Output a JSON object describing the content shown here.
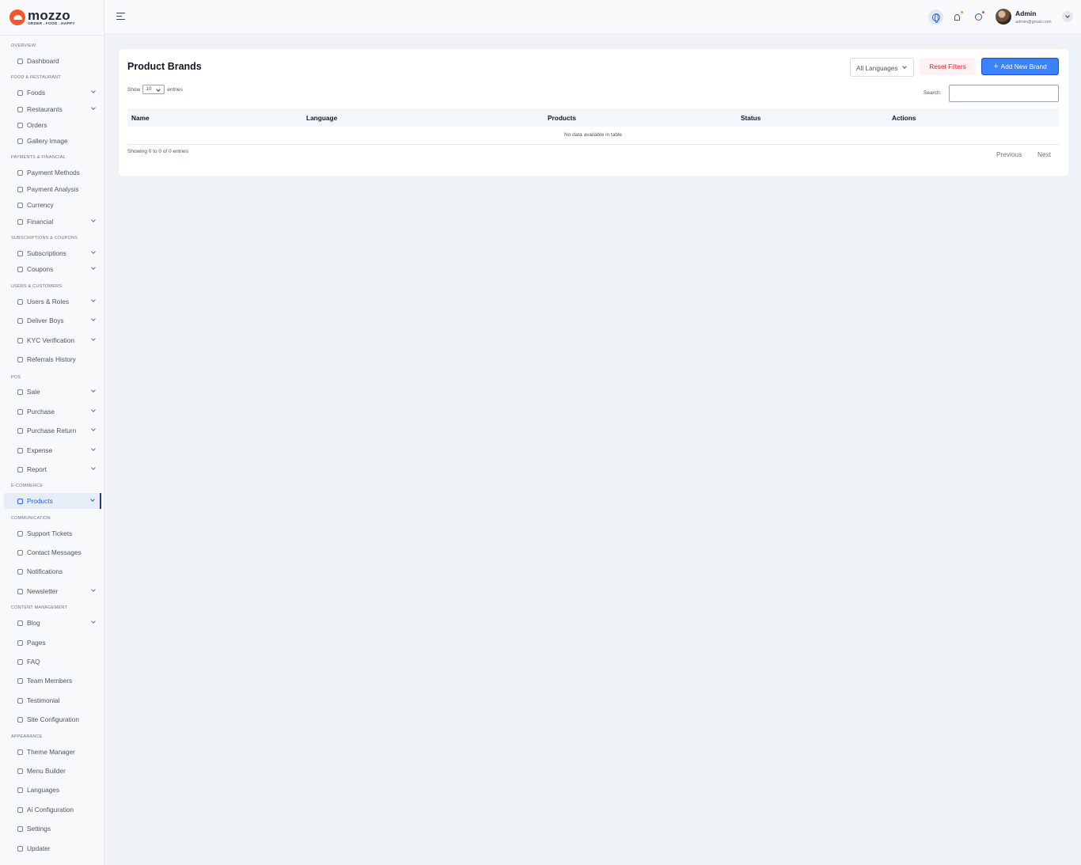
{
  "brand": {
    "name": "mozzo",
    "tagline": "ORDER . FOOD . HAPPY"
  },
  "sidebar": {
    "sections": [
      {
        "label": "OVERVIEW",
        "items": [
          {
            "label": "Dashboard",
            "icon": "home-icon",
            "expandable": false
          }
        ]
      },
      {
        "label": "FOOD & RESTAURANT",
        "items": [
          {
            "label": "Foods",
            "icon": "food-icon",
            "expandable": true
          },
          {
            "label": "Restaurants",
            "icon": "restaurant-icon",
            "expandable": true
          },
          {
            "label": "Orders",
            "icon": "orders-icon",
            "expandable": false
          },
          {
            "label": "Gallery Image",
            "icon": "gallery-icon",
            "expandable": false
          }
        ]
      },
      {
        "label": "PAYMENTS & FINANCIAL",
        "items": [
          {
            "label": "Payment Methods",
            "icon": "card-icon",
            "expandable": false
          },
          {
            "label": "Payment Analysis",
            "icon": "analysis-icon",
            "expandable": false
          },
          {
            "label": "Currency",
            "icon": "currency-icon",
            "expandable": false
          },
          {
            "label": "Financial",
            "icon": "financial-icon",
            "expandable": true
          }
        ]
      },
      {
        "label": "SUBSCRIPTIONS & COUPONS",
        "items": [
          {
            "label": "Subscriptions",
            "icon": "gift-icon",
            "expandable": true
          },
          {
            "label": "Coupons",
            "icon": "coupon-icon",
            "expandable": true
          }
        ]
      },
      {
        "label": "USERS & CUSTOMERS",
        "items": [
          {
            "label": "Users & Roles",
            "icon": "users-icon",
            "expandable": true
          },
          {
            "label": "Deliver Boys",
            "icon": "delivery-icon",
            "expandable": true
          },
          {
            "label": "KYC Verification",
            "icon": "kyc-icon",
            "expandable": true
          },
          {
            "label": "Referrals History",
            "icon": "referral-icon",
            "expandable": false
          }
        ]
      },
      {
        "label": "POS",
        "items": [
          {
            "label": "Sale",
            "icon": "sale-icon",
            "expandable": true
          },
          {
            "label": "Purchase",
            "icon": "purchase-icon",
            "expandable": true
          },
          {
            "label": "Purchase Return",
            "icon": "return-icon",
            "expandable": true
          },
          {
            "label": "Expense",
            "icon": "expense-icon",
            "expandable": true
          },
          {
            "label": "Report",
            "icon": "report-icon",
            "expandable": true
          }
        ]
      },
      {
        "label": "E-COMMERCE",
        "items": [
          {
            "label": "Products",
            "icon": "products-icon",
            "expandable": true,
            "active": true
          }
        ]
      },
      {
        "label": "COMMUNICATION",
        "items": [
          {
            "label": "Support Tickets",
            "icon": "ticket-icon",
            "expandable": false
          },
          {
            "label": "Contact Messages",
            "icon": "mail-icon",
            "expandable": false
          },
          {
            "label": "Notifications",
            "icon": "bell-icon",
            "expandable": false
          },
          {
            "label": "Newsletter",
            "icon": "newsletter-icon",
            "expandable": true
          }
        ]
      },
      {
        "label": "CONTENT MANAGEMENT",
        "items": [
          {
            "label": "Blog",
            "icon": "blog-icon",
            "expandable": true
          },
          {
            "label": "Pages",
            "icon": "page-icon",
            "expandable": false
          },
          {
            "label": "FAQ",
            "icon": "faq-icon",
            "expandable": false
          },
          {
            "label": "Team Members",
            "icon": "team-icon",
            "expandable": false
          },
          {
            "label": "Testimonial",
            "icon": "testimonial-icon",
            "expandable": false
          },
          {
            "label": "Site Configuration",
            "icon": "config-icon",
            "expandable": false
          }
        ]
      },
      {
        "label": "APPEARANCE",
        "items": [
          {
            "label": "Theme Manager",
            "icon": "theme-icon",
            "expandable": false
          },
          {
            "label": "Menu Builder",
            "icon": "menu-icon",
            "expandable": false
          },
          {
            "label": "Languages",
            "icon": "language-icon",
            "expandable": false
          },
          {
            "label": "Ai Configuration",
            "icon": "ai-icon",
            "expandable": false
          },
          {
            "label": "Settings",
            "icon": "gear-icon",
            "expandable": false
          },
          {
            "label": "Updater",
            "icon": "update-icon",
            "expandable": false
          }
        ]
      }
    ]
  },
  "topbar": {
    "user_name": "Admin",
    "user_email": "admin@gmail.com"
  },
  "main": {
    "title": "Product Brands",
    "language_filter": "All Languages",
    "reset_label": "Reset Filters",
    "add_label": "Add New Brand",
    "show_label": "Show",
    "page_length": "10",
    "entries_label": "entries",
    "search_label": "Search:",
    "search_value": "",
    "columns": [
      "Name",
      "Language",
      "Products",
      "Status",
      "Actions"
    ],
    "empty_message": "No data available in table",
    "info": "Showing 0 to 0 of 0 entries",
    "previous_label": "Previous",
    "next_label": "Next"
  },
  "colors": {
    "accent": "#3b82f6",
    "brand": "#f2562a",
    "danger": "#dc2626",
    "active_nav": "#2563eb"
  }
}
